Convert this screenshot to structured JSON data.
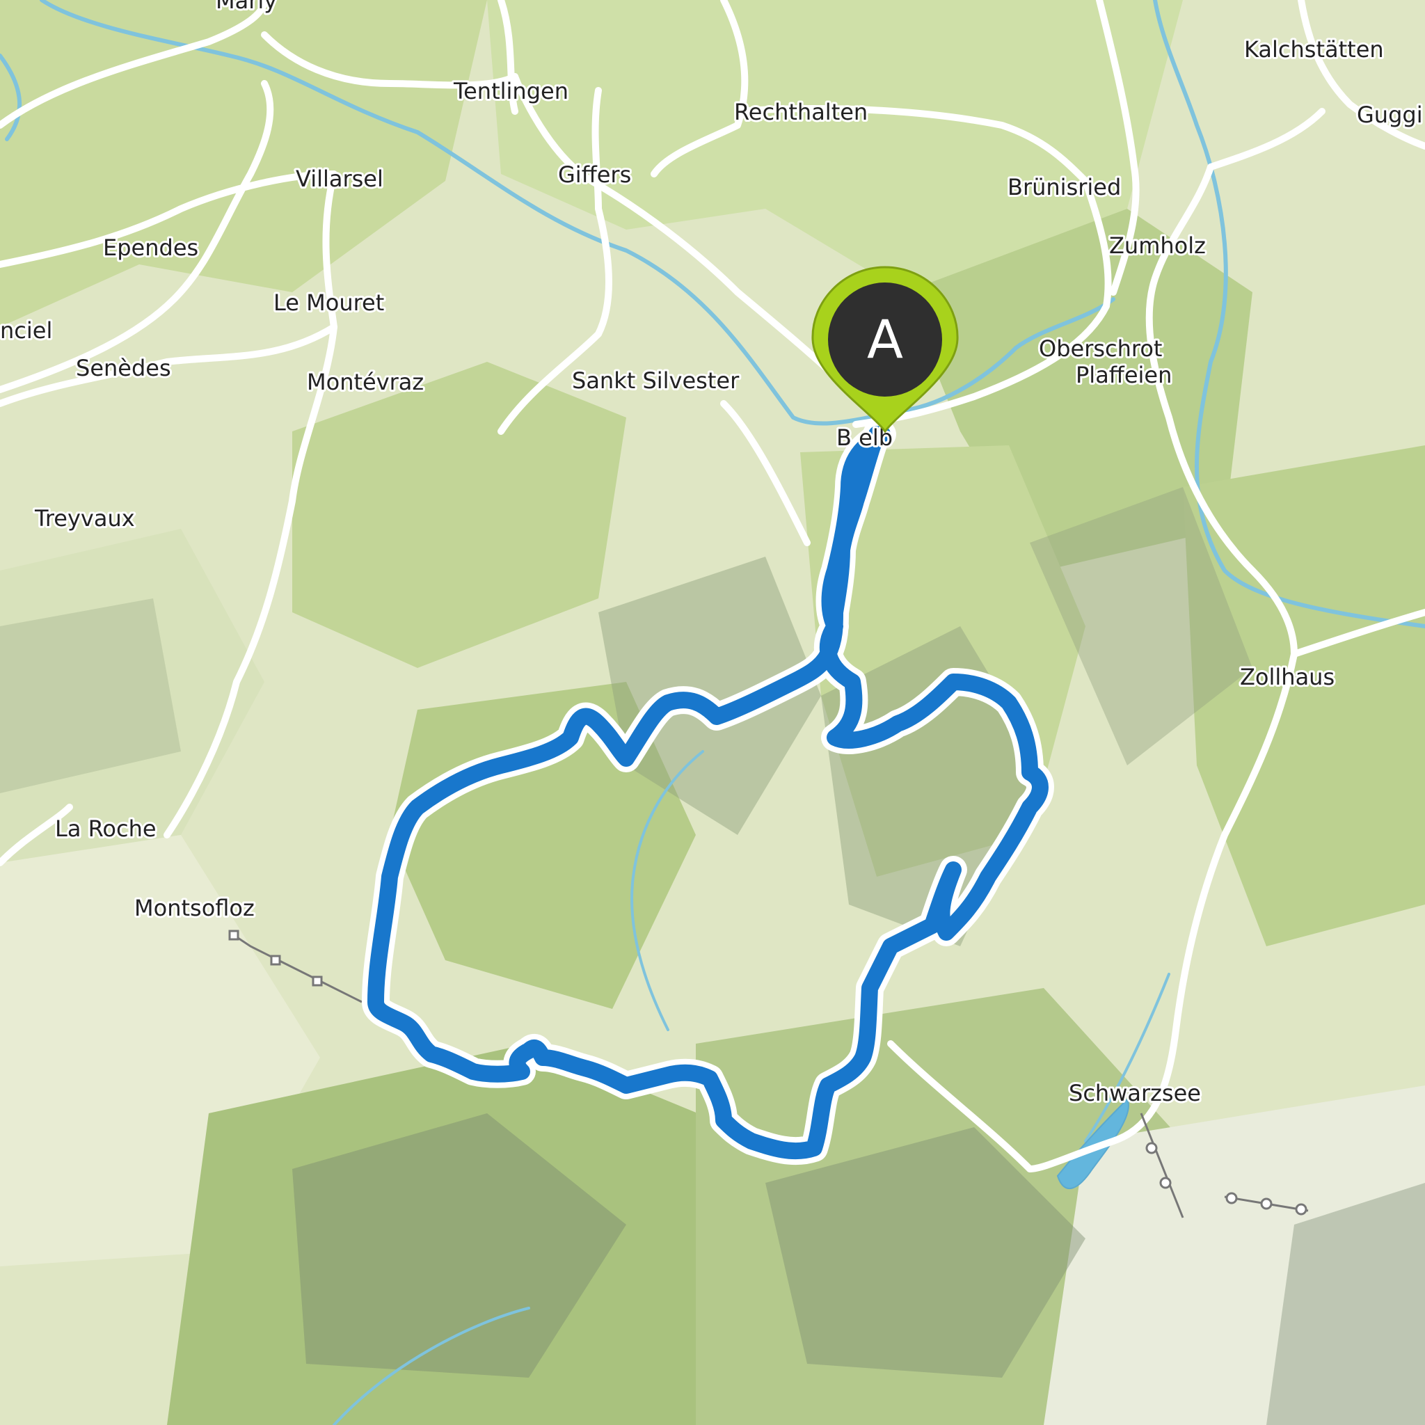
{
  "map": {
    "type": "topographic hiking route map",
    "colors": {
      "route": "#1877cc",
      "route_outline": "#ffffff",
      "marker": "#a8d21c",
      "marker_badge": "#2f2f2f",
      "water": "#7fc3dd",
      "lake": "#63b6dd",
      "road": "#ffffff",
      "terrain_light": "#e3e8c4",
      "terrain_green": "#c9da9e",
      "forest": "#b3cb86",
      "hill_shade": "#8a9a78"
    }
  },
  "marker": {
    "label": "A",
    "icon": "map-pin-icon"
  },
  "places": {
    "marly": "Marly",
    "tentlingen": "Tentlingen",
    "rechthalten": "Rechthalten",
    "kalchstatten": "Kalchstätten",
    "guggi": "Guggi",
    "villarsel": "Villarsel",
    "giffers": "Giffers",
    "brunisried": "Brünisried",
    "ependes": "Ependes",
    "zumholz": "Zumholz",
    "le_mouret": "Le Mouret",
    "anciel": "nciel",
    "oberschrot": "Oberschrot",
    "plaffeien": "Plaffeien",
    "senedes": "Senèdes",
    "montevraz": "Montévraz",
    "sankt_silvester": "Sankt Silvester",
    "brunnelb": "B     elb",
    "treyvaux": "Treyvaux",
    "zollhaus": "Zollhaus",
    "la_roche": "La Roche",
    "montsofloz": "Montsofloz",
    "schwarzsee": "Schwarzsee"
  }
}
